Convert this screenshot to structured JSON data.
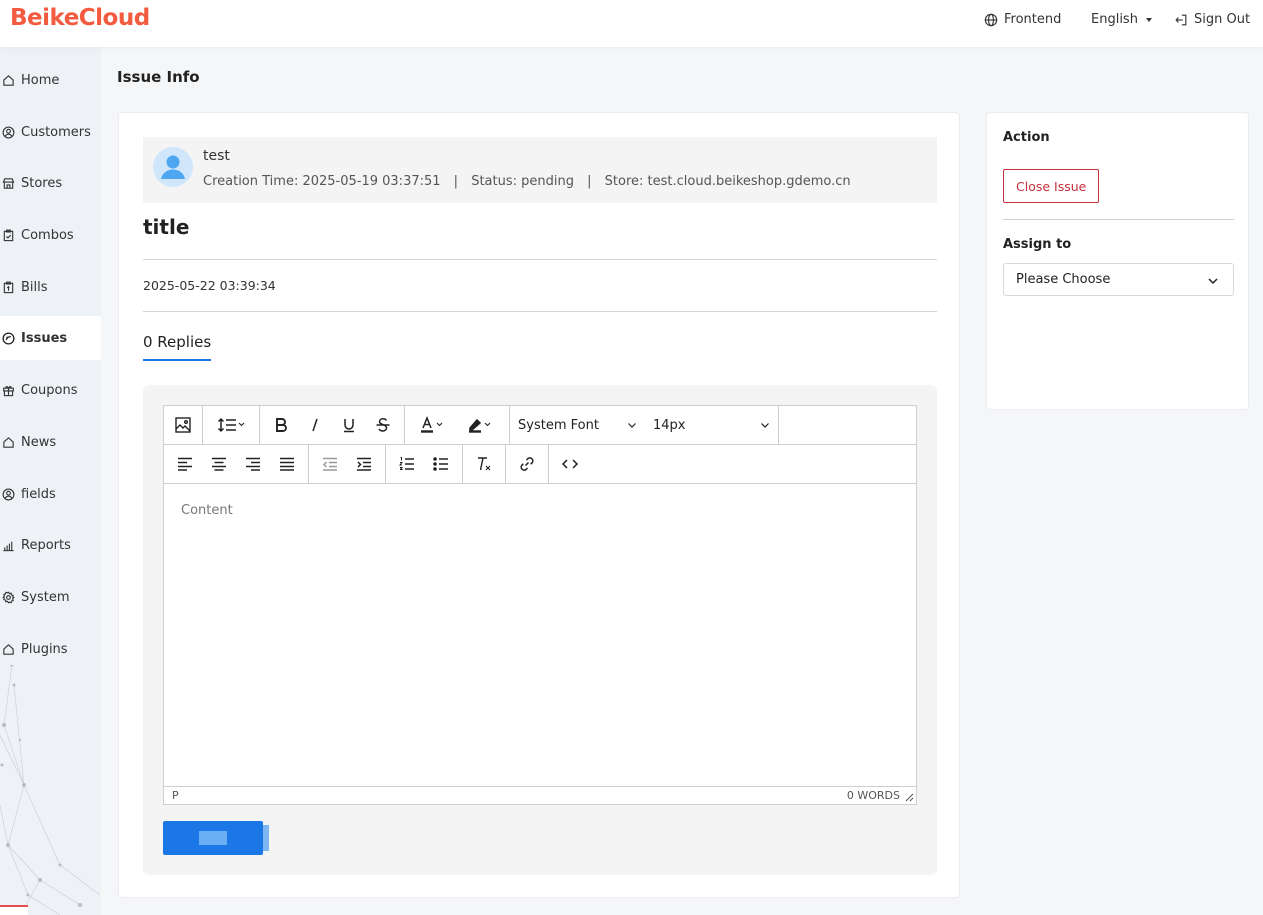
{
  "header": {
    "logo": "BeikeCloud",
    "frontend": "Frontend",
    "language": "English",
    "sign_out": "Sign Out"
  },
  "sidebar": {
    "items": [
      {
        "label": "Home",
        "icon": "home-icon"
      },
      {
        "label": "Customers",
        "icon": "user-circle-icon"
      },
      {
        "label": "Stores",
        "icon": "store-icon"
      },
      {
        "label": "Combos",
        "icon": "clipboard-check-icon"
      },
      {
        "label": "Bills",
        "icon": "bill-icon"
      },
      {
        "label": "Issues",
        "icon": "issue-icon",
        "active": true
      },
      {
        "label": "Coupons",
        "icon": "gift-icon"
      },
      {
        "label": "News",
        "icon": "home-icon"
      },
      {
        "label": "fields",
        "icon": "user-circle-icon"
      },
      {
        "label": "Reports",
        "icon": "bar-chart-icon"
      },
      {
        "label": "System",
        "icon": "gear-icon"
      },
      {
        "label": "Plugins",
        "icon": "home-icon"
      }
    ]
  },
  "page": {
    "title": "Issue Info"
  },
  "issue": {
    "author": "test",
    "creation_time": "Creation Time: 2025-05-19 03:37:51",
    "status": "Status: pending",
    "store": "Store: test.cloud.beikeshop.gdemo.cn",
    "separator": "|",
    "title": "title",
    "date": "2025-05-22 03:39:34",
    "replies_tab": "0 Replies"
  },
  "editor": {
    "font_family": "System Font",
    "font_size": "14px",
    "placeholder": "Content",
    "path": "P",
    "word_count": "0 WORDS"
  },
  "side_panel": {
    "action_label": "Action",
    "close_issue": "Close Issue",
    "assign_label": "Assign to",
    "assign_value": "Please Choose"
  },
  "colors": {
    "brand": "#f35b40",
    "primary": "#1a77e5",
    "danger": "#c9303c"
  }
}
